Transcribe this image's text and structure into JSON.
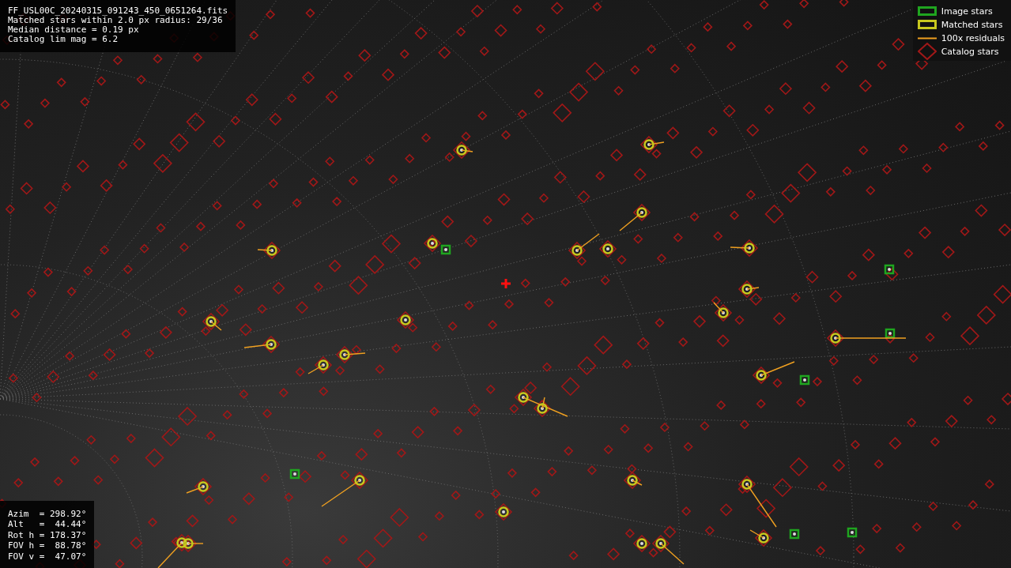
{
  "info_panel": {
    "lines": [
      "FF_USL00C_20240315_091243_450_0651264.fits",
      "Matched stars within 2.0 px radius: 29/36",
      "Median distance = 0.19 px",
      "Catalog lim mag = 6.2"
    ]
  },
  "legend": [
    {
      "kind": "image",
      "label": "Image stars"
    },
    {
      "kind": "matched",
      "label": "Matched stars"
    },
    {
      "kind": "residual",
      "label": "100x residuals"
    },
    {
      "kind": "catalog",
      "label": "Catalog stars"
    }
  ],
  "pointing_panel": {
    "lines": [
      "Azim  = 298.92°",
      "Alt   =  44.44°",
      "Rot h = 178.37°",
      "FOV h =  88.78°",
      "FOV v =  47.07°"
    ]
  }
}
